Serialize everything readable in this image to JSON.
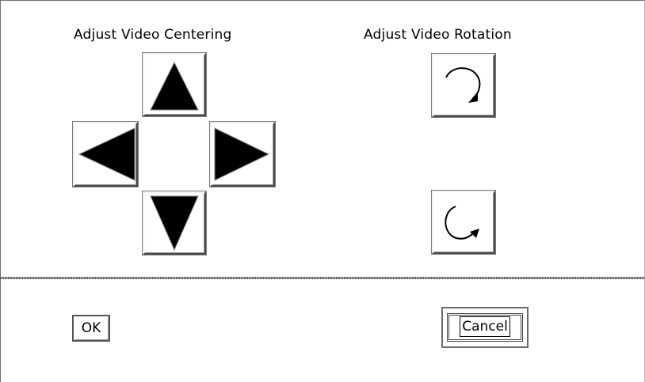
{
  "centering": {
    "title": "Adjust Video Centering"
  },
  "rotation": {
    "title": "Adjust Video Rotation"
  },
  "buttons": {
    "ok": "OK",
    "cancel": "Cancel"
  }
}
